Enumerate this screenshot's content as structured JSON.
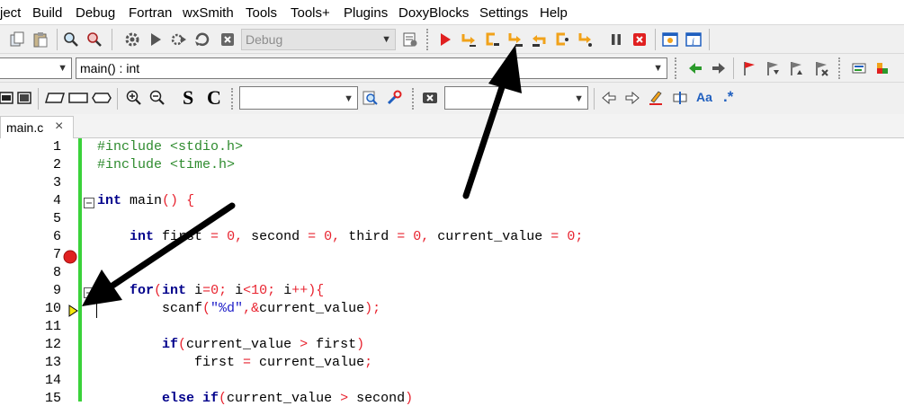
{
  "menu": [
    "ject",
    "Build",
    "Debug",
    "Fortran",
    "wxSmith",
    "Tools",
    "Tools+",
    "Plugins",
    "DoxyBlocks",
    "Settings",
    "Help"
  ],
  "toolbar": {
    "build_target": "Debug",
    "scope": "",
    "function": "main() : int",
    "search_text": "",
    "replace_text": "",
    "bold_s": "S",
    "bold_c": "C",
    "aa": "Aa",
    "regex": ".*"
  },
  "tab": {
    "label": "main.c",
    "close": "×"
  },
  "editor": {
    "line_numbers": [
      "1",
      "2",
      "3",
      "4",
      "5",
      "6",
      "7",
      "8",
      "9",
      "10",
      "11",
      "12",
      "13",
      "14",
      "15"
    ],
    "breakpoint_line": "7",
    "current_line": "10",
    "lines": [
      {
        "parts": [
          [
            "pp",
            "#include <stdio.h>"
          ]
        ]
      },
      {
        "parts": [
          [
            "pp",
            "#include <time.h>"
          ]
        ]
      },
      {
        "parts": []
      },
      {
        "parts": [
          [
            "kw",
            "int"
          ],
          [
            "id",
            " main"
          ],
          [
            "op",
            "()"
          ],
          [
            "id",
            " "
          ],
          [
            "op",
            "{"
          ]
        ]
      },
      {
        "parts": []
      },
      {
        "parts": [
          [
            "id",
            "    "
          ],
          [
            "kw",
            "int"
          ],
          [
            "id",
            " first "
          ],
          [
            "op",
            "="
          ],
          [
            "id",
            " "
          ],
          [
            "num",
            "0"
          ],
          [
            "op",
            ","
          ],
          [
            "id",
            " second "
          ],
          [
            "op",
            "="
          ],
          [
            "id",
            " "
          ],
          [
            "num",
            "0"
          ],
          [
            "op",
            ","
          ],
          [
            "id",
            " third "
          ],
          [
            "op",
            "="
          ],
          [
            "id",
            " "
          ],
          [
            "num",
            "0"
          ],
          [
            "op",
            ","
          ],
          [
            "id",
            " current_value "
          ],
          [
            "op",
            "="
          ],
          [
            "id",
            " "
          ],
          [
            "num",
            "0"
          ],
          [
            "op",
            ";"
          ]
        ]
      },
      {
        "parts": []
      },
      {
        "parts": []
      },
      {
        "parts": [
          [
            "id",
            "    "
          ],
          [
            "kw",
            "for"
          ],
          [
            "op",
            "("
          ],
          [
            "kw",
            "int"
          ],
          [
            "id",
            " i"
          ],
          [
            "op",
            "="
          ],
          [
            "num",
            "0"
          ],
          [
            "op",
            ";"
          ],
          [
            "id",
            " i"
          ],
          [
            "op",
            "<"
          ],
          [
            "num",
            "10"
          ],
          [
            "op",
            ";"
          ],
          [
            "id",
            " i"
          ],
          [
            "op",
            "++){"
          ]
        ]
      },
      {
        "parts": [
          [
            "id",
            "        scanf"
          ],
          [
            "op",
            "("
          ],
          [
            "str",
            "\"%d\""
          ],
          [
            "op",
            ",&"
          ],
          [
            "id",
            "current_value"
          ],
          [
            "op",
            ");"
          ]
        ]
      },
      {
        "parts": []
      },
      {
        "parts": [
          [
            "id",
            "        "
          ],
          [
            "kw",
            "if"
          ],
          [
            "op",
            "("
          ],
          [
            "id",
            "current_value "
          ],
          [
            "op",
            ">"
          ],
          [
            "id",
            " first"
          ],
          [
            "op",
            ")"
          ]
        ]
      },
      {
        "parts": [
          [
            "id",
            "            first "
          ],
          [
            "op",
            "="
          ],
          [
            "id",
            " current_value"
          ],
          [
            "op",
            ";"
          ]
        ]
      },
      {
        "parts": []
      },
      {
        "parts": [
          [
            "id",
            "        "
          ],
          [
            "kw",
            "else if"
          ],
          [
            "op",
            "("
          ],
          [
            "id",
            "current_value "
          ],
          [
            "op",
            ">"
          ],
          [
            "id",
            " second"
          ],
          [
            "op",
            ")"
          ]
        ]
      }
    ]
  },
  "colors": {
    "breakpoint": "#e02020",
    "changebar": "#3ad23a",
    "arrow": "#000000"
  }
}
